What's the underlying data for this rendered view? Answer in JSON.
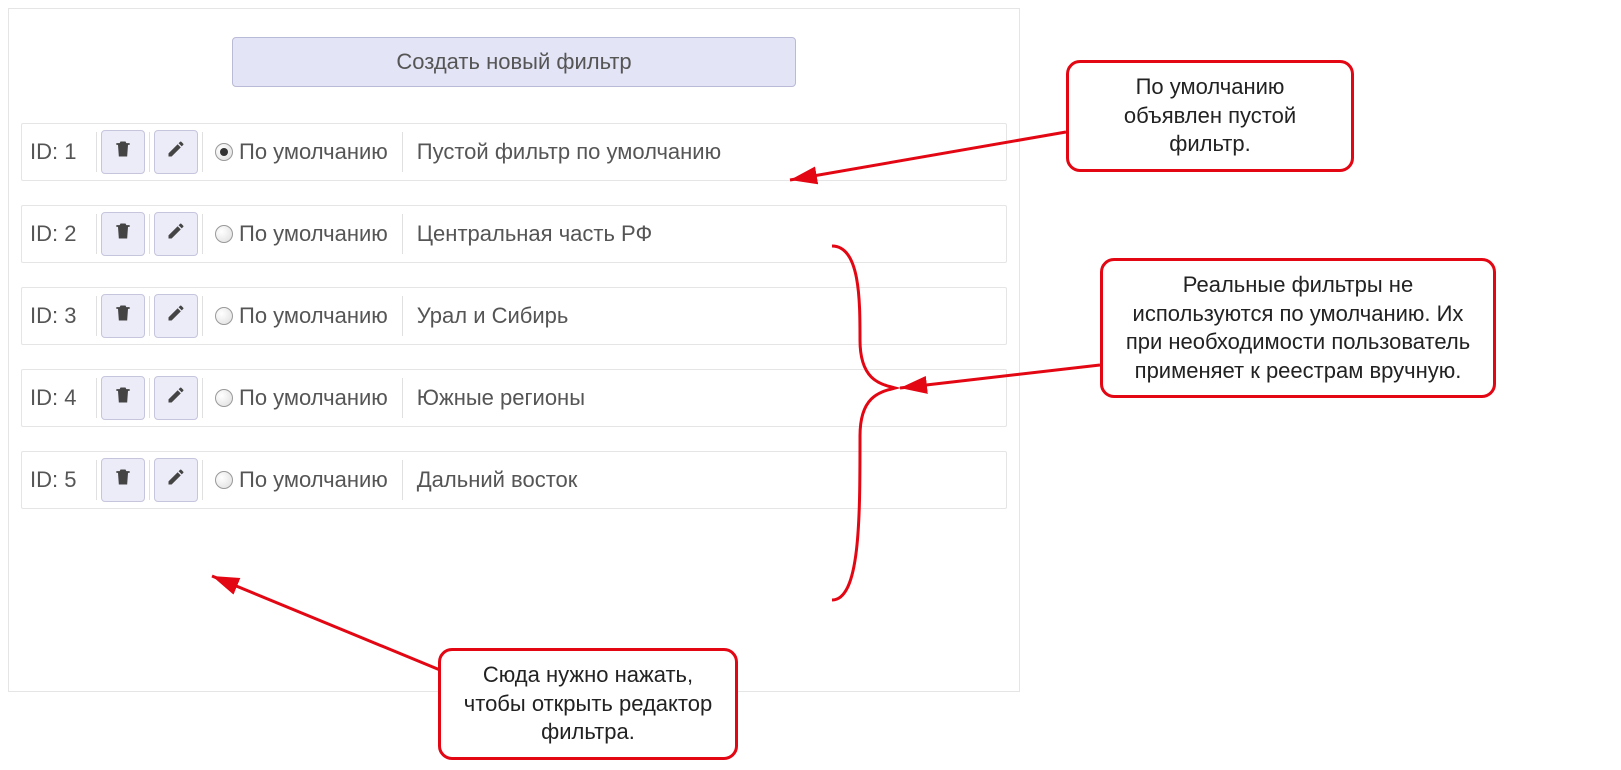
{
  "create_label": "Создать новый фильтр",
  "id_prefix": "ID: ",
  "default_label": "По умолчанию",
  "filters": [
    {
      "id": "1",
      "default": true,
      "name": "Пустой фильтр по умолчанию"
    },
    {
      "id": "2",
      "default": false,
      "name": "Центральная часть РФ"
    },
    {
      "id": "3",
      "default": false,
      "name": "Урал и Сибирь"
    },
    {
      "id": "4",
      "default": false,
      "name": "Южные регионы"
    },
    {
      "id": "5",
      "default": false,
      "name": "Дальний восток"
    }
  ],
  "callouts": {
    "top": "По умолчанию объявлен пустой фильтр.",
    "middle": "Реальные фильтры не используются по умолчанию. Их при необходимости пользователь применяет к реестрам вручную.",
    "bottom": "Сюда нужно нажать, чтобы открыть редактор фильтра."
  }
}
